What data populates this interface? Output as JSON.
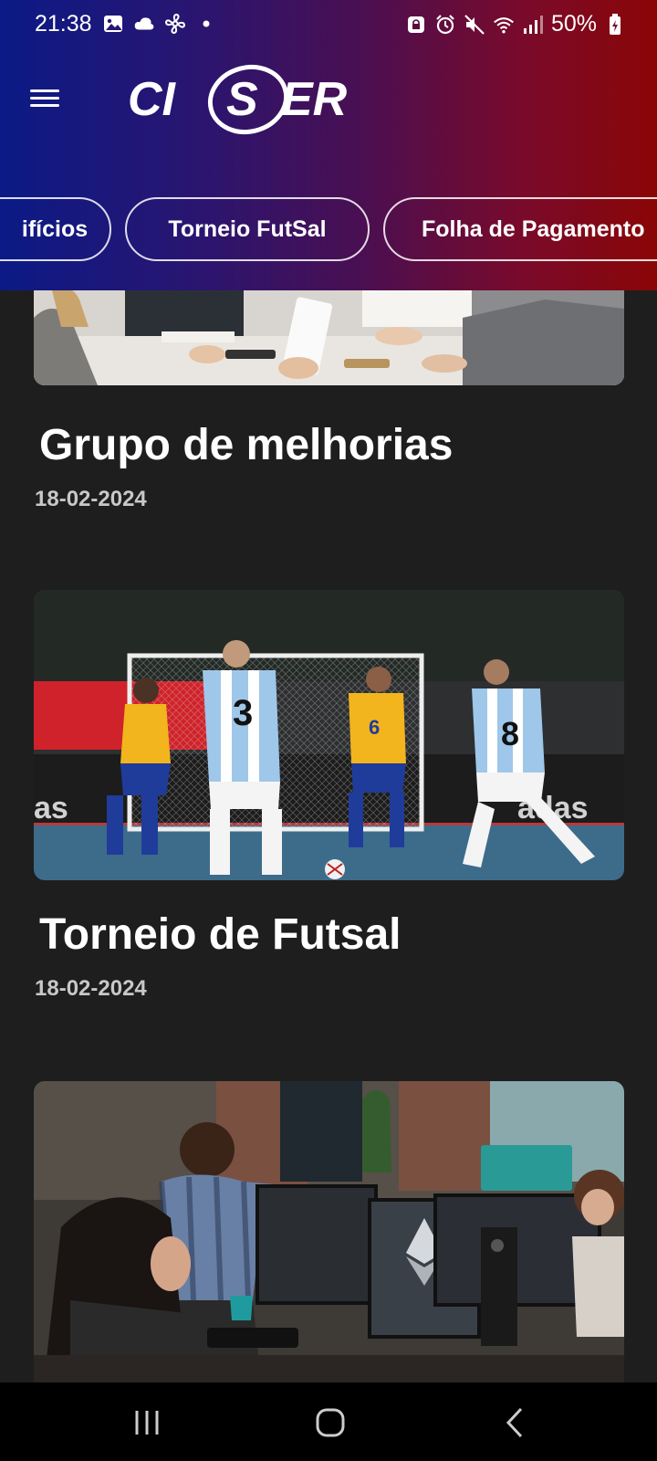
{
  "status_bar": {
    "time": "21:38",
    "battery": "50%"
  },
  "app": {
    "logo_text": "CISER"
  },
  "tabs": [
    {
      "label": "ifícios"
    },
    {
      "label": "Torneio FutSal"
    },
    {
      "label": "Folha de Pagamento"
    }
  ],
  "news": [
    {
      "title": "Grupo de melhorias",
      "date": "18-02-2024"
    },
    {
      "title": "Torneio de Futsal",
      "date": "18-02-2024"
    }
  ],
  "colors": {
    "header_left": "#0b1a86",
    "header_right": "#8a0606",
    "background": "#1e1e1e",
    "date_text": "#c8c8c8"
  },
  "icons": {
    "status_left": [
      "gallery-icon",
      "cloud-icon",
      "fan-icon",
      "dot-icon"
    ],
    "status_right": [
      "lock-icon",
      "alarm-icon",
      "mute-icon",
      "wifi-icon",
      "signal-icon",
      "battery-icon"
    ],
    "nav": [
      "recents-icon",
      "home-icon",
      "back-icon"
    ]
  }
}
